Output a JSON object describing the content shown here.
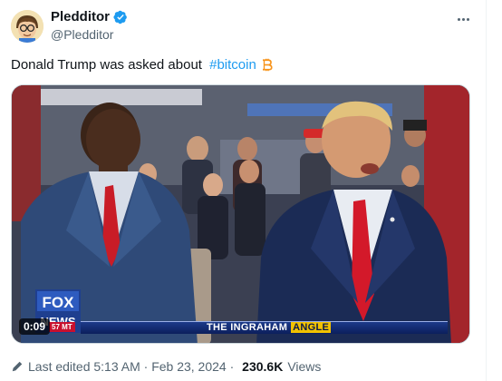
{
  "author": {
    "display_name": "Pledditor",
    "handle": "@Pledditor",
    "verified": true
  },
  "tweet": {
    "text_prefix": "Donald Trump was asked about ",
    "hashtag": "#bitcoin",
    "hashtag_icon": "bitcoin-icon"
  },
  "video": {
    "timestamp": "0:09",
    "network_logo": "FOX NEWS",
    "time_tag": "57 MT",
    "show_title_prefix": "THE INGRAHAM",
    "show_title_highlight": "ANGLE"
  },
  "footer": {
    "edited_text": "Last edited 5:13 AM · Feb 23, 2024 · ",
    "views_count": "230.6K",
    "views_label": "Views"
  },
  "colors": {
    "link": "#1d9bf0",
    "secondary_text": "#536471",
    "verified_badge": "#1d9bf0",
    "bitcoin_orange": "#f7931a"
  }
}
